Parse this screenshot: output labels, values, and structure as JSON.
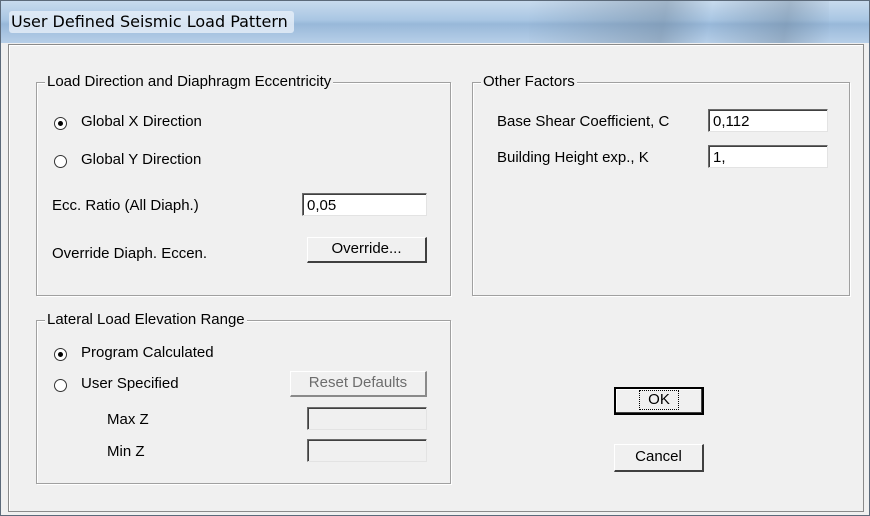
{
  "window": {
    "title": "User Defined Seismic Load Pattern"
  },
  "load_direction": {
    "legend": "Load Direction and Diaphragm Eccentricity",
    "options": [
      {
        "label": "Global X Direction",
        "checked": true
      },
      {
        "label": "Global Y Direction",
        "checked": false
      }
    ],
    "ecc_label": "Ecc. Ratio (All Diaph.)",
    "ecc_value": "0,05",
    "override_label": "Override Diaph. Eccen.",
    "override_button": "Override..."
  },
  "other_factors": {
    "legend": "Other Factors",
    "base_shear_label": "Base Shear Coefficient, C",
    "base_shear_value": "0,112",
    "height_exp_label": "Building Height exp., K",
    "height_exp_value": "1,"
  },
  "elevation_range": {
    "legend": "Lateral Load Elevation Range",
    "options": [
      {
        "label": "Program Calculated",
        "checked": true
      },
      {
        "label": "User Specified",
        "checked": false
      }
    ],
    "reset_button": "Reset Defaults",
    "max_z_label": "Max Z",
    "max_z_value": "",
    "min_z_label": "Min Z",
    "min_z_value": ""
  },
  "buttons": {
    "ok": "OK",
    "cancel": "Cancel"
  }
}
